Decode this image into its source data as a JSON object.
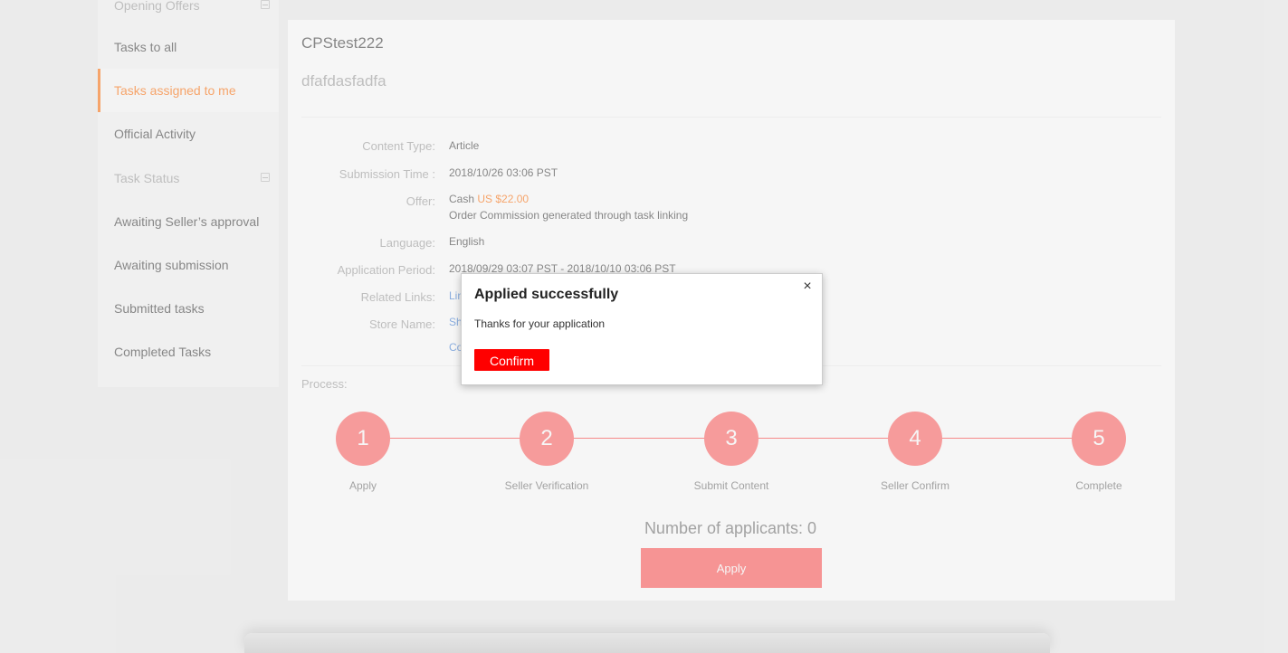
{
  "sidebar": {
    "items": [
      {
        "label": "Opening Offers",
        "group": true
      },
      {
        "label": "Tasks to all"
      },
      {
        "label": "Tasks assigned to me",
        "active": true
      },
      {
        "label": "Official Activity"
      },
      {
        "label": "Task Status",
        "group": true
      },
      {
        "label": "Awaiting Seller’s approval"
      },
      {
        "label": "Awaiting submission"
      },
      {
        "label": "Submitted tasks"
      },
      {
        "label": "Completed Tasks"
      }
    ]
  },
  "task": {
    "title": "CPStest222",
    "subtitle": "dfafdasfadfa",
    "fields": {
      "content_type_label": "Content Type:",
      "content_type_value": "Article",
      "submission_time_label": "Submission Time :",
      "submission_time_value": "2018/10/26 03:06 PST",
      "offer_label": "Offer:",
      "offer_cash_prefix": "Cash",
      "offer_cash_amount": "US $22.00",
      "offer_commission": "Order Commission generated through task linking",
      "language_label": "Language:",
      "language_value": "English",
      "application_period_label": "Application Period:",
      "application_period_value": "2018/09/29 03:07 PST - 2018/10/10 03:06 PST",
      "related_links_label": "Related Links:",
      "related_links_value": "Lin",
      "store_name_label": "Store Name:",
      "store_name_value": "Sh",
      "extra_link": "Co"
    },
    "process_label": "Process:",
    "steps": [
      {
        "number": "1",
        "label": "Apply"
      },
      {
        "number": "2",
        "label": "Seller Verification"
      },
      {
        "number": "3",
        "label": "Submit Content"
      },
      {
        "number": "4",
        "label": "Seller Confirm"
      },
      {
        "number": "5",
        "label": "Complete"
      }
    ],
    "applicants_text": "Number of applicants: 0",
    "apply_label": "Apply"
  },
  "modal": {
    "title": "Applied successfully",
    "close_glyph": "×",
    "message": "Thanks for your application",
    "confirm_label": "Confirm"
  },
  "colors": {
    "accent": "#ff6a00",
    "step": "#ff5a5a",
    "confirm": "#ff0000"
  }
}
